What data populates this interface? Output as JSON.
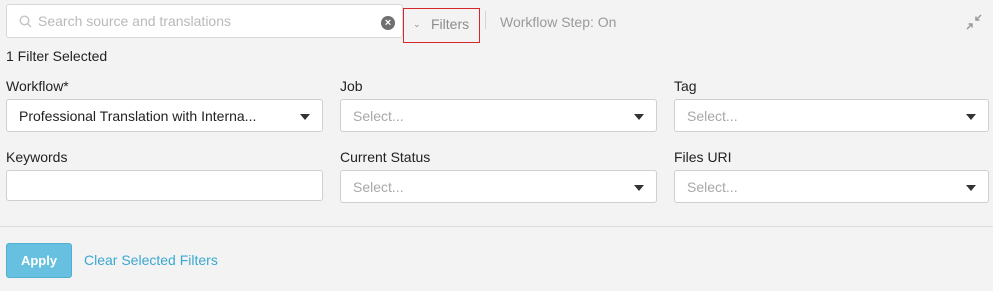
{
  "search": {
    "placeholder": "Search source and translations"
  },
  "toolbar": {
    "filters_label": "Filters",
    "workflow_step": "Workflow Step: On"
  },
  "filter_count": "1 Filter Selected",
  "filters": {
    "workflow": {
      "label": "Workflow*",
      "value": "Professional Translation with Interna..."
    },
    "job": {
      "label": "Job",
      "value": "Select..."
    },
    "tag": {
      "label": "Tag",
      "value": "Select..."
    },
    "keywords": {
      "label": "Keywords",
      "value": ""
    },
    "current_status": {
      "label": "Current Status",
      "value": "Select..."
    },
    "files_uri": {
      "label": "Files URI",
      "value": "Select..."
    }
  },
  "actions": {
    "apply_label": "Apply",
    "clear_label": "Clear Selected Filters"
  },
  "colors": {
    "accent": "#3aa8d1",
    "apply_bg": "#67c0df",
    "highlight_border": "#d62828"
  }
}
